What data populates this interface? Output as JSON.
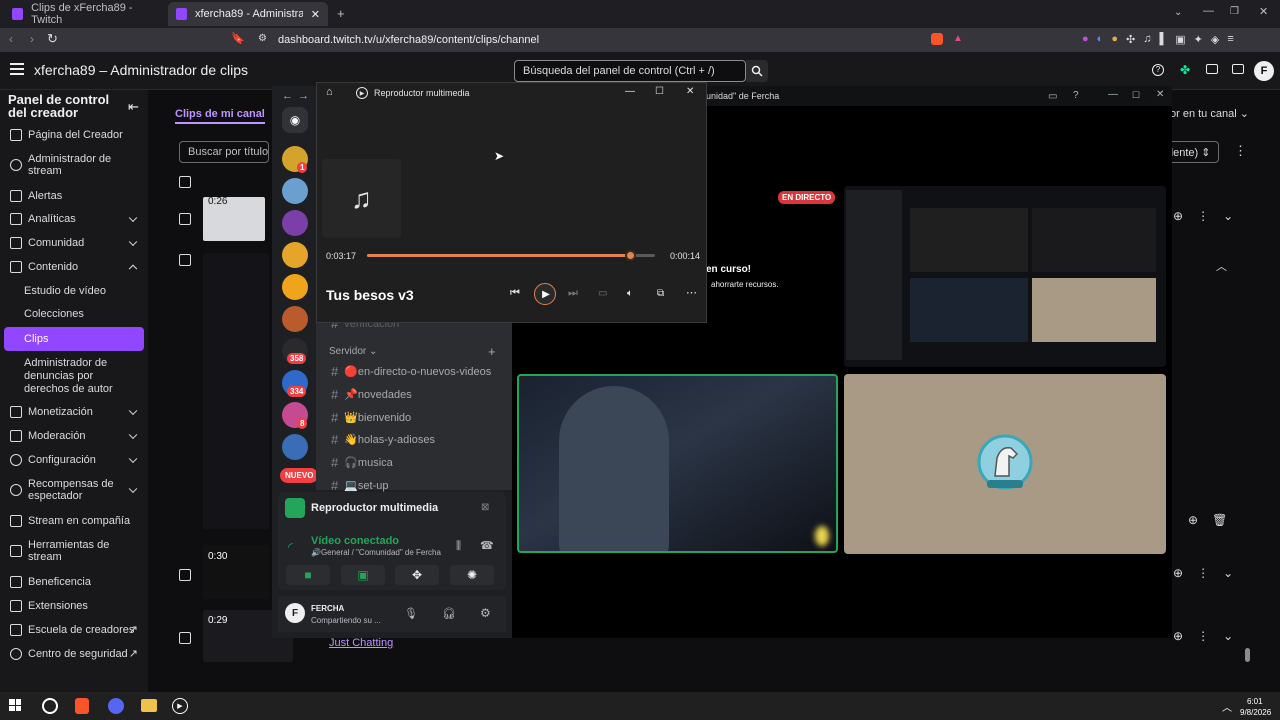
{
  "browser": {
    "tabs": [
      {
        "label": "Clips de xFercha89 - Twitch",
        "active": false
      },
      {
        "label": "xfercha89 - Administrador de clip",
        "active": true
      }
    ],
    "url": "dashboard.twitch.tv/u/xfercha89/content/clips/channel"
  },
  "header": {
    "title": "xfercha89 – Administrador de clips",
    "search_placeholder": "Búsqueda del panel de control (Ctrl + /)",
    "avatar_letter": "F"
  },
  "sidebar": {
    "title": "Panel de control del creador",
    "items": [
      {
        "label": "Página del Creador"
      },
      {
        "label": "Administrador de stream"
      },
      {
        "label": "Alertas"
      },
      {
        "label": "Analíticas"
      },
      {
        "label": "Comunidad"
      },
      {
        "label": "Contenido"
      },
      {
        "label": "Estudio de vídeo"
      },
      {
        "label": "Colecciones"
      },
      {
        "label": "Clips"
      },
      {
        "label": "Administrador de denuncias por derechos de autor"
      },
      {
        "label": "Monetización"
      },
      {
        "label": "Moderación"
      },
      {
        "label": "Configuración"
      },
      {
        "label": "Recompensas de espectador"
      },
      {
        "label": "Stream en compañía"
      },
      {
        "label": "Herramientas de stream"
      },
      {
        "label": "Beneficencia"
      },
      {
        "label": "Extensiones"
      },
      {
        "label": "Escuela de creadores"
      },
      {
        "label": "Centro de seguridad"
      }
    ]
  },
  "clips": {
    "tab_label": "Clips de mi canal",
    "search_placeholder": "Buscar por título",
    "filter_label": "or en tu canal",
    "order_label": "dente)",
    "rows": [
      {
        "duration": "0:26"
      },
      {
        "duration": "0:30"
      },
      {
        "duration": "0:29",
        "category": "Just Chatting"
      }
    ]
  },
  "discord": {
    "servers": [
      {
        "badge": "1"
      },
      {
        "badge": ""
      },
      {
        "badge": ""
      },
      {
        "badge": ""
      },
      {
        "badge": ""
      },
      {
        "badge": ""
      },
      {
        "badge": "358"
      },
      {
        "badge": "334"
      },
      {
        "badge": "8"
      },
      {
        "badge": ""
      }
    ],
    "new_badge": "NUEVO",
    "partial_channel": "verificación",
    "category": "Servidor",
    "channels": [
      {
        "label": "🔴en-directo-o-nuevos-videos"
      },
      {
        "label": "📌novedades"
      },
      {
        "label": "👑bienvenido"
      },
      {
        "label": "👋holas-y-adioses"
      },
      {
        "label": "🎧musica"
      },
      {
        "label": "💻set-up"
      }
    ],
    "activity_title": "Reproductor multimedia",
    "voice_status": "Vídeo conectado",
    "voice_channel": "🔊General / \"Comunidad\" de Fercha",
    "user_name": "FERCHA",
    "user_status": "Compartiendo su ..."
  },
  "stream": {
    "window_title": "unidad\" de Fercha",
    "live_label": "EN DIRECTO",
    "notice_title": "en curso!",
    "notice_sub": "ahorrarte recursos."
  },
  "player": {
    "title": "Reproductor multimedia",
    "time_elapsed": "0:03:17",
    "time_remaining": "0:00:14",
    "progress": 0.913,
    "song": "Tus besos v3"
  },
  "taskbar": {
    "time": "6:01",
    "date": "9/8/2026"
  },
  "colors": {
    "twitch_purple": "#9146ff",
    "player_accent": "#e1854f",
    "discord_green": "#23a55a",
    "live_red": "#da373c"
  }
}
